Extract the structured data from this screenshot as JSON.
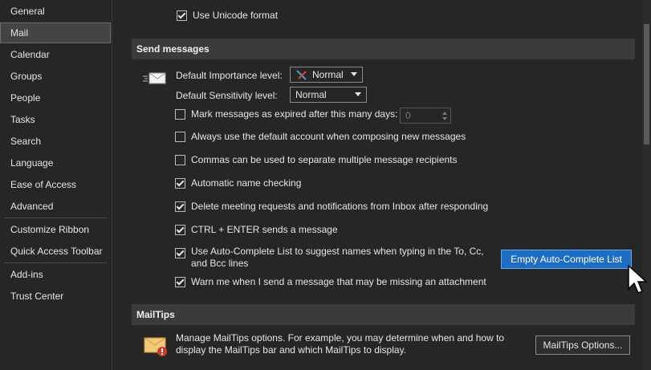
{
  "sidebar": {
    "items": [
      {
        "label": "General"
      },
      {
        "label": "Mail"
      },
      {
        "label": "Calendar"
      },
      {
        "label": "Groups"
      },
      {
        "label": "People"
      },
      {
        "label": "Tasks"
      },
      {
        "label": "Search"
      },
      {
        "label": "Language"
      },
      {
        "label": "Ease of Access"
      },
      {
        "label": "Advanced"
      },
      {
        "label": "Customize Ribbon"
      },
      {
        "label": "Quick Access Toolbar"
      },
      {
        "label": "Add-ins"
      },
      {
        "label": "Trust Center"
      }
    ],
    "selected": "Mail"
  },
  "top_option": {
    "label": "Use Unicode format",
    "checked": true
  },
  "send_messages": {
    "header": "Send messages",
    "importance_label": "Default Importance level:",
    "importance_value": "Normal",
    "sensitivity_label": "Default Sensitivity level:",
    "sensitivity_value": "Normal",
    "options": [
      {
        "label": "Mark messages as expired after this many days:",
        "checked": false
      },
      {
        "label": "Always use the default account when composing new messages",
        "checked": false
      },
      {
        "label": "Commas can be used to separate multiple message recipients",
        "checked": false
      },
      {
        "label": "Automatic name checking",
        "checked": true
      },
      {
        "label": "Delete meeting requests and notifications from Inbox after responding",
        "checked": true
      },
      {
        "label": "CTRL + ENTER sends a message",
        "checked": true
      },
      {
        "label": "Use Auto-Complete List to suggest names when typing in the To, Cc,",
        "label2": "and Bcc lines",
        "checked": true
      },
      {
        "label": "Warn me when I send a message that may be missing an attachment",
        "checked": true
      }
    ],
    "expire_days_value": "0",
    "empty_autocomplete_button": "Empty Auto-Complete List"
  },
  "mailtips": {
    "header": "MailTips",
    "description_line1": "Manage MailTips options. For example, you may determine when and how to",
    "description_line2": "display the MailTips bar and which MailTips to display.",
    "button": "MailTips Options..."
  },
  "colors": {
    "accent": "#1d6ec2",
    "background": "#262626",
    "section_header": "#3b3b3b"
  }
}
